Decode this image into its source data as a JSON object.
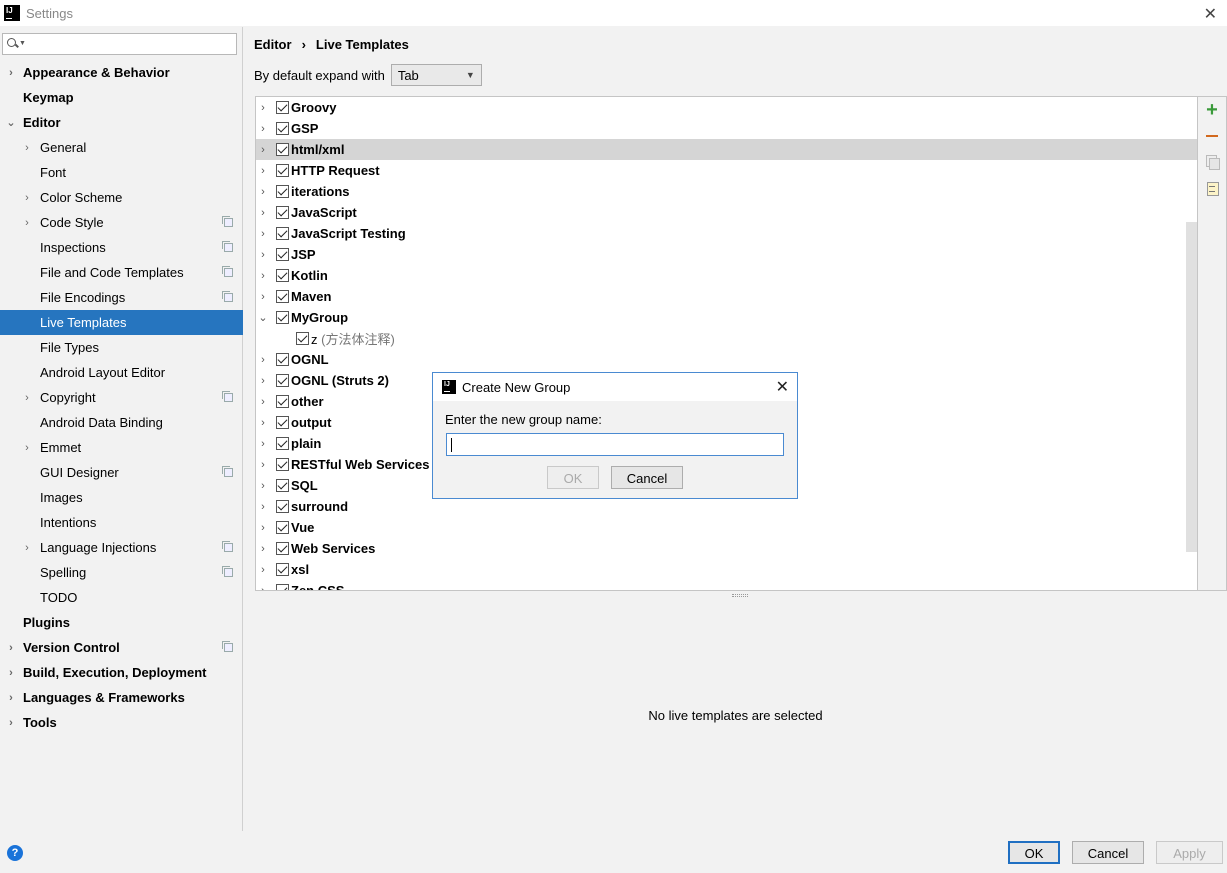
{
  "window": {
    "title": "Settings",
    "logo_text": "IJ"
  },
  "search": {
    "placeholder": "",
    "value": ""
  },
  "sidebar": {
    "items": [
      {
        "label": "Appearance & Behavior",
        "level": 0,
        "arrow": "›",
        "copy": false,
        "selected": false
      },
      {
        "label": "Keymap",
        "level": 0,
        "arrow": "",
        "copy": false,
        "selected": false
      },
      {
        "label": "Editor",
        "level": 0,
        "arrow": "⌄",
        "copy": false,
        "selected": false
      },
      {
        "label": "General",
        "level": 1,
        "arrow": "›",
        "copy": false,
        "selected": false
      },
      {
        "label": "Font",
        "level": 1,
        "arrow": "",
        "copy": false,
        "selected": false
      },
      {
        "label": "Color Scheme",
        "level": 1,
        "arrow": "›",
        "copy": false,
        "selected": false
      },
      {
        "label": "Code Style",
        "level": 1,
        "arrow": "›",
        "copy": true,
        "selected": false
      },
      {
        "label": "Inspections",
        "level": 1,
        "arrow": "",
        "copy": true,
        "selected": false
      },
      {
        "label": "File and Code Templates",
        "level": 1,
        "arrow": "",
        "copy": true,
        "selected": false
      },
      {
        "label": "File Encodings",
        "level": 1,
        "arrow": "",
        "copy": true,
        "selected": false
      },
      {
        "label": "Live Templates",
        "level": 1,
        "arrow": "",
        "copy": false,
        "selected": true
      },
      {
        "label": "File Types",
        "level": 1,
        "arrow": "",
        "copy": false,
        "selected": false
      },
      {
        "label": "Android Layout Editor",
        "level": 1,
        "arrow": "",
        "copy": false,
        "selected": false
      },
      {
        "label": "Copyright",
        "level": 1,
        "arrow": "›",
        "copy": true,
        "selected": false
      },
      {
        "label": "Android Data Binding",
        "level": 1,
        "arrow": "",
        "copy": false,
        "selected": false
      },
      {
        "label": "Emmet",
        "level": 1,
        "arrow": "›",
        "copy": false,
        "selected": false
      },
      {
        "label": "GUI Designer",
        "level": 1,
        "arrow": "",
        "copy": true,
        "selected": false
      },
      {
        "label": "Images",
        "level": 1,
        "arrow": "",
        "copy": false,
        "selected": false
      },
      {
        "label": "Intentions",
        "level": 1,
        "arrow": "",
        "copy": false,
        "selected": false
      },
      {
        "label": "Language Injections",
        "level": 1,
        "arrow": "›",
        "copy": true,
        "selected": false
      },
      {
        "label": "Spelling",
        "level": 1,
        "arrow": "",
        "copy": true,
        "selected": false
      },
      {
        "label": "TODO",
        "level": 1,
        "arrow": "",
        "copy": false,
        "selected": false
      },
      {
        "label": "Plugins",
        "level": 0,
        "arrow": "",
        "copy": false,
        "selected": false
      },
      {
        "label": "Version Control",
        "level": 0,
        "arrow": "›",
        "copy": true,
        "selected": false
      },
      {
        "label": "Build, Execution, Deployment",
        "level": 0,
        "arrow": "›",
        "copy": false,
        "selected": false
      },
      {
        "label": "Languages & Frameworks",
        "level": 0,
        "arrow": "›",
        "copy": false,
        "selected": false
      },
      {
        "label": "Tools",
        "level": 0,
        "arrow": "›",
        "copy": false,
        "selected": false
      }
    ]
  },
  "main": {
    "breadcrumb": {
      "part1": "Editor",
      "separator": "›",
      "part2": "Live Templates"
    },
    "expand_label": "By default expand with",
    "expand_value": "Tab",
    "templates": [
      {
        "label": "Groovy",
        "arrow": "›",
        "child": false,
        "highlight": false
      },
      {
        "label": "GSP",
        "arrow": "›",
        "child": false,
        "highlight": false
      },
      {
        "label": "html/xml",
        "arrow": "›",
        "child": false,
        "highlight": true
      },
      {
        "label": "HTTP Request",
        "arrow": "›",
        "child": false,
        "highlight": false
      },
      {
        "label": "iterations",
        "arrow": "›",
        "child": false,
        "highlight": false
      },
      {
        "label": "JavaScript",
        "arrow": "›",
        "child": false,
        "highlight": false
      },
      {
        "label": "JavaScript Testing",
        "arrow": "›",
        "child": false,
        "highlight": false
      },
      {
        "label": "JSP",
        "arrow": "›",
        "child": false,
        "highlight": false
      },
      {
        "label": "Kotlin",
        "arrow": "›",
        "child": false,
        "highlight": false
      },
      {
        "label": "Maven",
        "arrow": "›",
        "child": false,
        "highlight": false
      },
      {
        "label": "MyGroup",
        "arrow": "⌄",
        "child": false,
        "highlight": false
      },
      {
        "label": "z",
        "desc": " (方法体注释)",
        "arrow": "",
        "child": true,
        "highlight": false
      },
      {
        "label": "OGNL",
        "arrow": "›",
        "child": false,
        "highlight": false
      },
      {
        "label": "OGNL (Struts 2)",
        "arrow": "›",
        "child": false,
        "highlight": false
      },
      {
        "label": "other",
        "arrow": "›",
        "child": false,
        "highlight": false
      },
      {
        "label": "output",
        "arrow": "›",
        "child": false,
        "highlight": false
      },
      {
        "label": "plain",
        "arrow": "›",
        "child": false,
        "highlight": false
      },
      {
        "label": "RESTful Web Services",
        "arrow": "›",
        "child": false,
        "highlight": false
      },
      {
        "label": "SQL",
        "arrow": "›",
        "child": false,
        "highlight": false
      },
      {
        "label": "surround",
        "arrow": "›",
        "child": false,
        "highlight": false
      },
      {
        "label": "Vue",
        "arrow": "›",
        "child": false,
        "highlight": false
      },
      {
        "label": "Web Services",
        "arrow": "›",
        "child": false,
        "highlight": false
      },
      {
        "label": "xsl",
        "arrow": "›",
        "child": false,
        "highlight": false
      },
      {
        "label": "Zen CSS",
        "arrow": "›",
        "child": false,
        "highlight": false
      }
    ],
    "empty_message": "No live templates are selected"
  },
  "dialog": {
    "title": "Create New Group",
    "label": "Enter the new group name:",
    "input_value": "",
    "ok_label": "OK",
    "cancel_label": "Cancel"
  },
  "footer": {
    "help_label": "?",
    "ok_label": "OK",
    "cancel_label": "Cancel",
    "apply_label": "Apply"
  }
}
